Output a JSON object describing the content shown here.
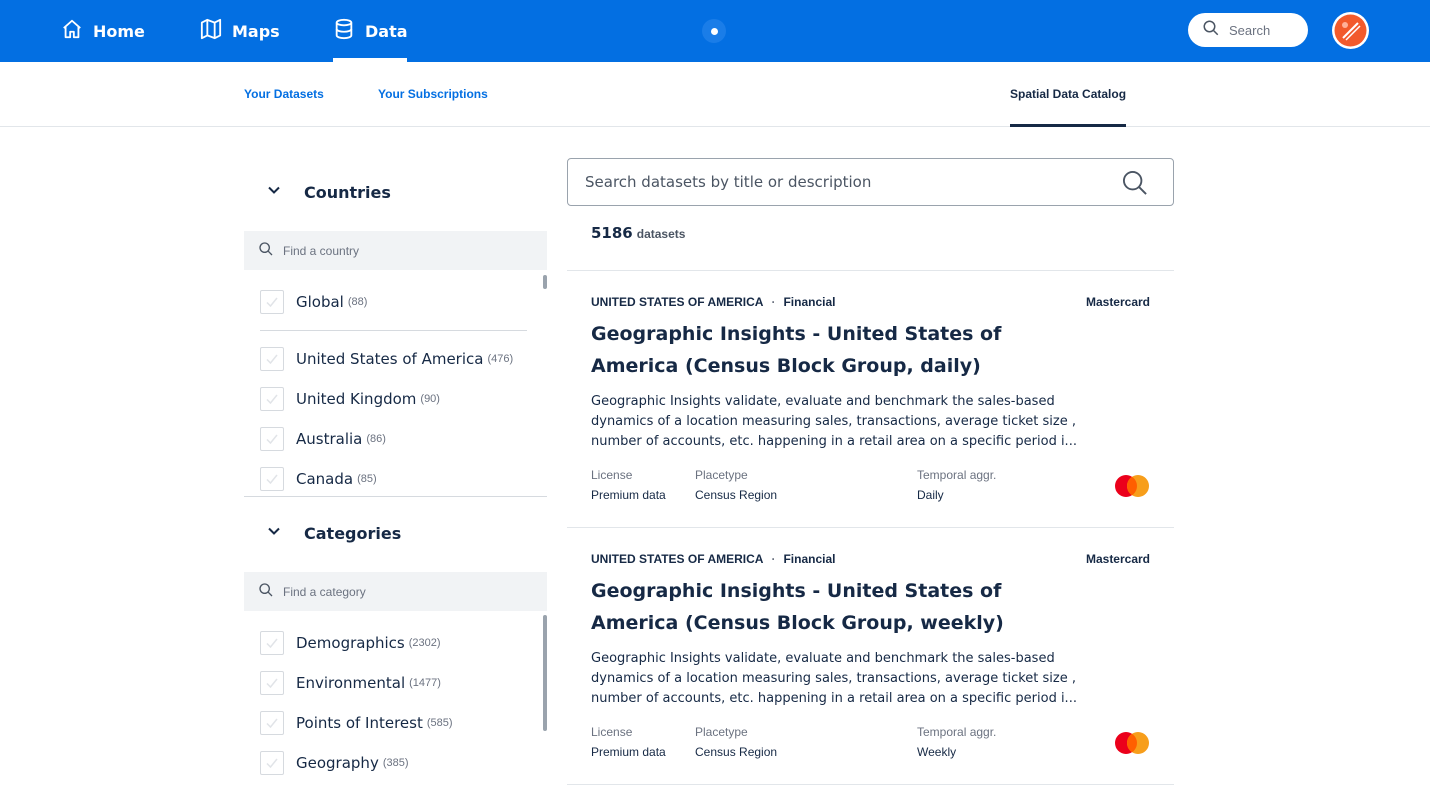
{
  "topnav": {
    "home_label": "Home",
    "maps_label": "Maps",
    "data_label": "Data",
    "search_placeholder": "Search",
    "active": "Data",
    "brand_color": "#036fe2"
  },
  "subnav": {
    "your_datasets": "Your Datasets",
    "your_subscriptions": "Your Subscriptions",
    "catalog": "Spatial Data Catalog"
  },
  "sidebar": {
    "countries": {
      "title": "Countries",
      "search_placeholder": "Find a country",
      "options": [
        {
          "label": "Global",
          "count": "(88)"
        },
        {
          "label": "United States of America",
          "count": "(476)"
        },
        {
          "label": "United Kingdom",
          "count": "(90)"
        },
        {
          "label": "Australia",
          "count": "(86)"
        },
        {
          "label": "Canada",
          "count": "(85)"
        }
      ]
    },
    "categories": {
      "title": "Categories",
      "search_placeholder": "Find a category",
      "options": [
        {
          "label": "Demographics",
          "count": "(2302)"
        },
        {
          "label": "Environmental",
          "count": "(1477)"
        },
        {
          "label": "Points of Interest",
          "count": "(585)"
        },
        {
          "label": "Geography",
          "count": "(385)"
        }
      ]
    }
  },
  "main": {
    "search_placeholder": "Search datasets by title or description",
    "count_number": "5186",
    "count_label": "datasets",
    "results": [
      {
        "country": "UNITED STATES OF AMERICA",
        "category": "Financial",
        "provider": "Mastercard",
        "title": "Geographic Insights - United States of America (Census Block Group, daily)",
        "description": "Geographic Insights validate, evaluate and benchmark the sales-based dynamics of a location measuring sales, transactions, average ticket size , number of accounts, etc. happening in a retail area on a specific period i...",
        "license_label": "License",
        "license": "Premium data",
        "placetype_label": "Placetype",
        "placetype": "Census Region",
        "temporal_label": "Temporal aggr.",
        "temporal": "Daily",
        "logo_icon": "mastercard-logo-icon"
      },
      {
        "country": "UNITED STATES OF AMERICA",
        "category": "Financial",
        "provider": "Mastercard",
        "title": "Geographic Insights - United States of America (Census Block Group, weekly)",
        "description": "Geographic Insights validate, evaluate and benchmark the sales-based dynamics of a location measuring sales, transactions, average ticket size , number of accounts, etc. happening in a retail area on a specific period i...",
        "license_label": "License",
        "license": "Premium data",
        "placetype_label": "Placetype",
        "placetype": "Census Region",
        "temporal_label": "Temporal aggr.",
        "temporal": "Weekly",
        "logo_icon": "mastercard-logo-icon"
      }
    ]
  }
}
